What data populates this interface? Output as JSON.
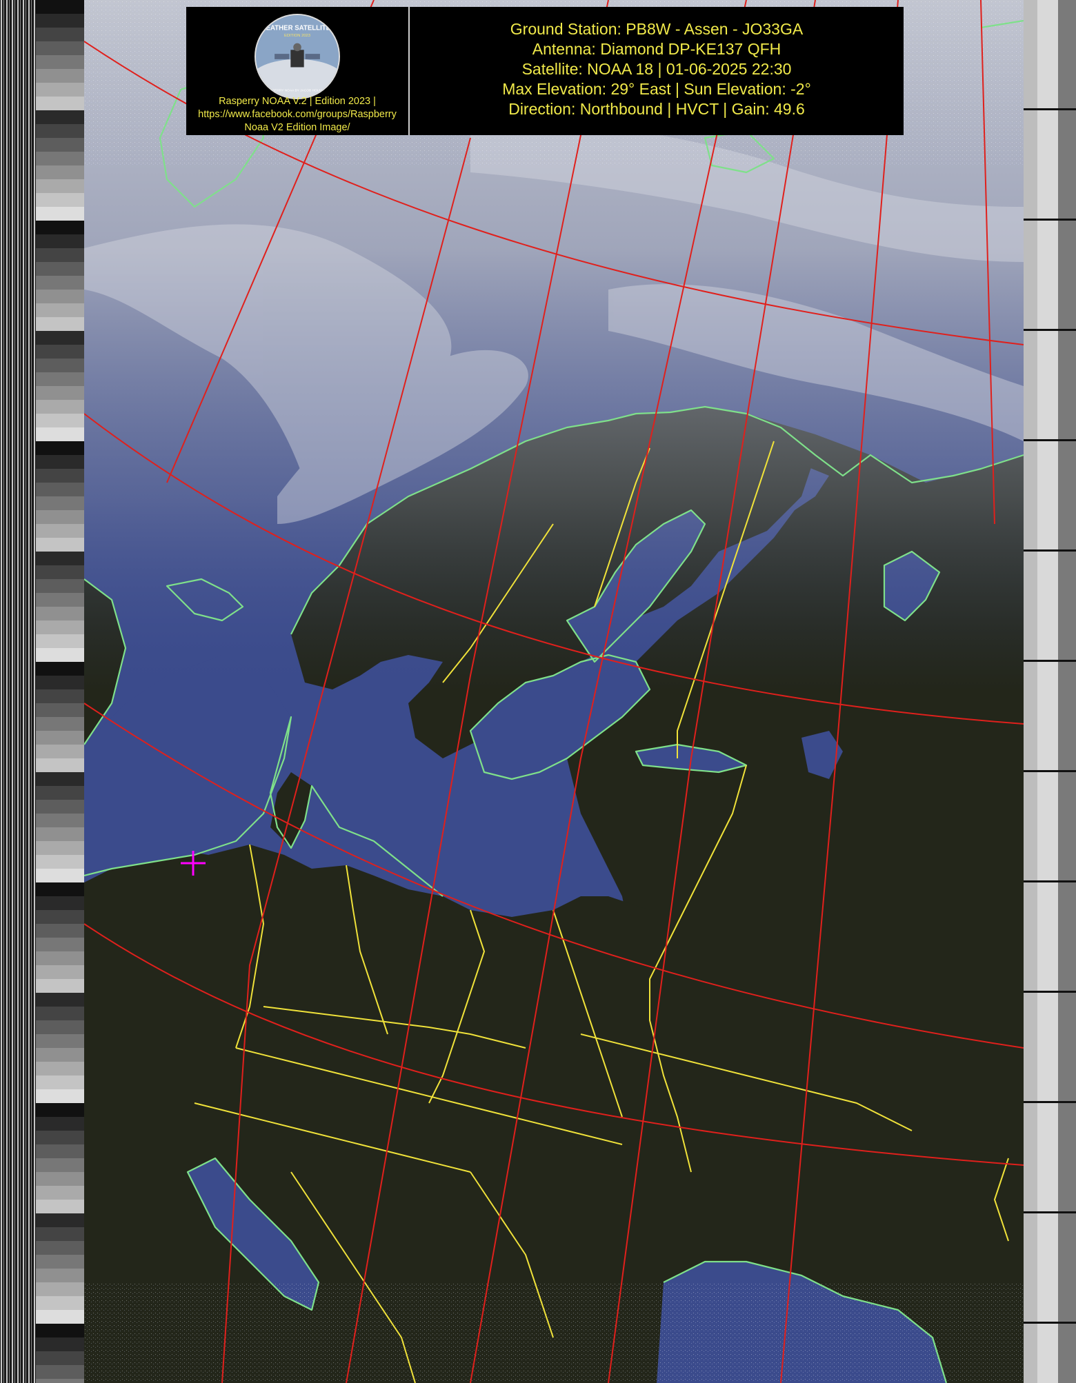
{
  "header": {
    "logo": {
      "badge_text_top": "WEATHER SATELLITES",
      "badge_text_edition": "EDITION 2023",
      "badge_text_bottom": "RASPBERRY NOAA BY JACOB HOLMBERG",
      "icon": "satellite-icon",
      "caption_lines": [
        "Rasperry NOAA V.2 | Edition 2023 |",
        "https://www.facebook.com/groups/Raspberry",
        "Noaa V2 Edition Image/"
      ]
    },
    "pass_info": {
      "ground_station": "Ground Station: PB8W - Assen - JO33GA",
      "antenna": "Antenna: Diamond DP-KE137 QFH",
      "satellite": "Satellite: NOAA 18 | 01-06-2025 22:30",
      "elevation": "Max Elevation: 29° East | Sun Elevation: -2°",
      "direction": "Direction: Northbound | HVCT | Gain: 49.6"
    }
  },
  "map": {
    "colors": {
      "sea": "#3b4b8c",
      "land": "#23261a",
      "cloud": "#b4b8c4",
      "coastline": "#7fe08a",
      "border": "#f0e23a",
      "graticule": "#e0201c",
      "station_marker": "#ff00ff"
    },
    "station_marker": "crosshair-icon"
  }
}
